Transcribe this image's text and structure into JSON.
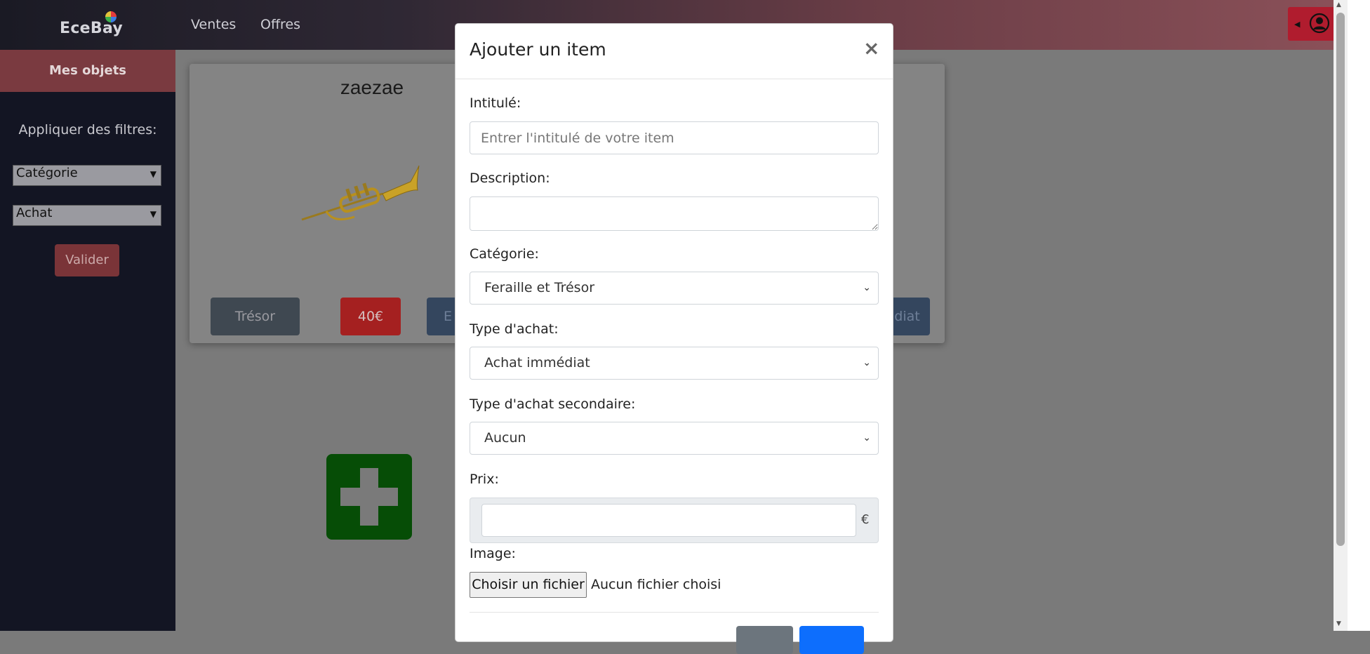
{
  "navbar": {
    "brand": "EceBay",
    "links": [
      "Ventes",
      "Offres"
    ]
  },
  "sidebar": {
    "heading": "Mes objets",
    "filters_label": "Appliquer des filtres:",
    "category_select": "Catégorie",
    "purchase_select": "Achat",
    "apply_button": "Valider"
  },
  "card": {
    "title": "zaezae",
    "category_button": "Trésor",
    "price_button": "40€",
    "partial_left": "E",
    "partial_right": "diat"
  },
  "modal": {
    "title": "Ajouter un item",
    "close_symbol": "×",
    "title_label": "Intitulé:",
    "title_placeholder": "Entrer l'intitulé de votre item",
    "description_label": "Description:",
    "category_label": "Catégorie:",
    "category_value": "Feraille et Trésor",
    "purchase_type_label": "Type d'achat:",
    "purchase_type_value": "Achat immédiat",
    "secondary_type_label": "Type d'achat secondaire:",
    "secondary_type_value": "Aucun",
    "price_label": "Prix:",
    "currency": "€",
    "image_label": "Image:",
    "file_button": "Choisir un fichier",
    "file_status": "Aucun fichier choisi"
  },
  "colors": {
    "add_tile": "#064d06",
    "price_badge": "#a52020",
    "user_button": "#b01c2e"
  },
  "icons": [
    "user-circle-icon",
    "close-icon",
    "plus-icon",
    "chevron-down-icon",
    "trumpet-image"
  ]
}
